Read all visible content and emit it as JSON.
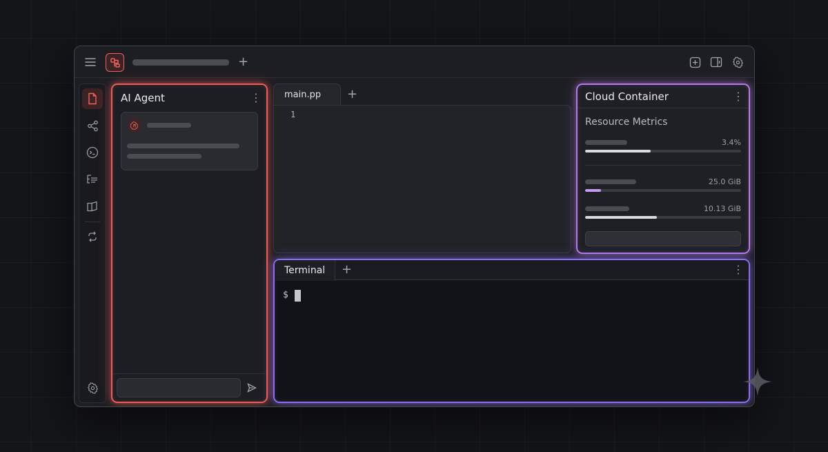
{
  "titlebar": {
    "menu_icon": "hamburger-icon",
    "logo_icon": "app-logo-icon",
    "new_tab_icon": "plus-icon",
    "right_icons": [
      "add-square-icon",
      "split-view-icon",
      "settings-gear-icon"
    ]
  },
  "sidebar": {
    "items": [
      {
        "icon": "file-icon",
        "active": true
      },
      {
        "icon": "share-icon",
        "active": false
      },
      {
        "icon": "terminal-icon",
        "active": false
      },
      {
        "icon": "tree-icon",
        "active": false
      },
      {
        "icon": "book-icon",
        "active": false
      },
      {
        "icon": "sync-arrows-icon",
        "active": false
      }
    ],
    "bottom_icon": "settings-gear-icon"
  },
  "agent": {
    "title": "AI Agent",
    "menu_icon": "kebab-menu-icon",
    "send_icon": "send-icon",
    "accent": "#ef5d58"
  },
  "editor": {
    "tab_label": "main.pp",
    "line_numbers": [
      "1"
    ]
  },
  "cloud": {
    "title": "Cloud Container",
    "section_title": "Resource Metrics",
    "accent": "#b57ae8",
    "metrics": [
      {
        "value": "3.4%",
        "fill_fraction": 0.42,
        "fill_color": "#d9dae0"
      },
      {
        "value": "25.0 GiB",
        "fill_fraction": 0.1,
        "fill_color": "#c79af0"
      },
      {
        "value": "10.13 GiB",
        "fill_fraction": 0.46,
        "fill_color": "#d9dae0"
      }
    ]
  },
  "terminal": {
    "tab_label": "Terminal",
    "prompt": "$",
    "accent": "#8c6ff0"
  }
}
